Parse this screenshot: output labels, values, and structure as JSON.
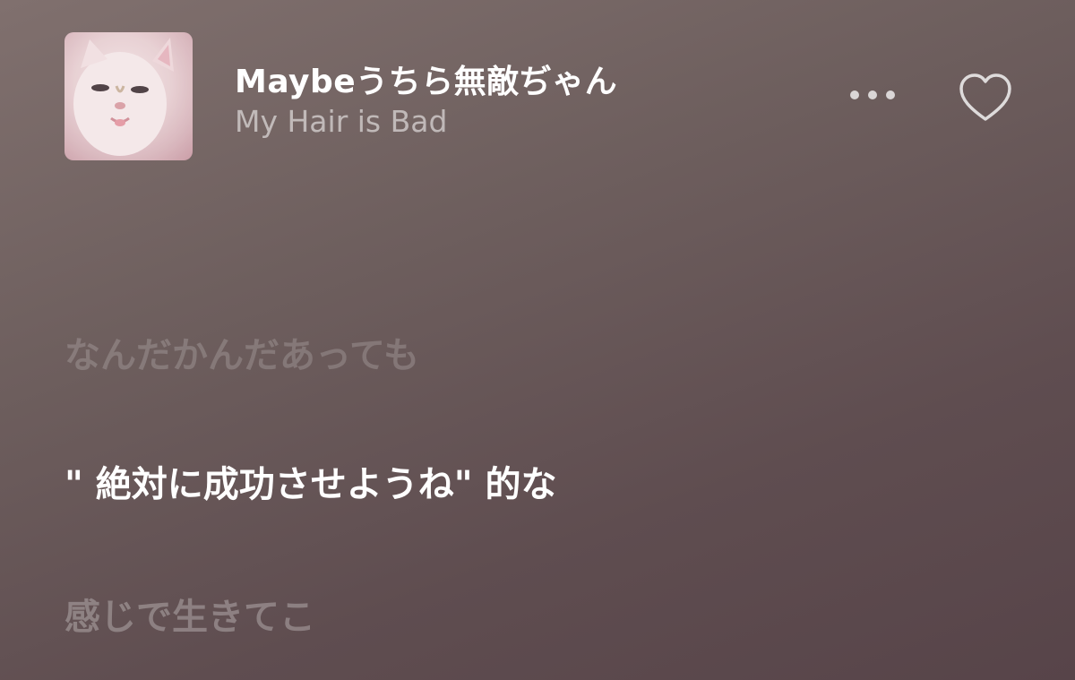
{
  "now_playing": {
    "title": "Maybeうちら無敵ぢゃん",
    "artist": "My Hair is Bad",
    "artwork_icon": "cat-artwork",
    "more_icon": "ellipsis-icon",
    "love_icon": "heart-outline-icon"
  },
  "lyrics": {
    "previous_line": "なんだかんだあっても",
    "current_line": "\" 絶対に成功させようね\" 的な",
    "next_line": "感じで生きてこ"
  },
  "colors": {
    "background_top": "#80706e",
    "background_bottom": "#574449",
    "text_active": "#ffffff"
  }
}
